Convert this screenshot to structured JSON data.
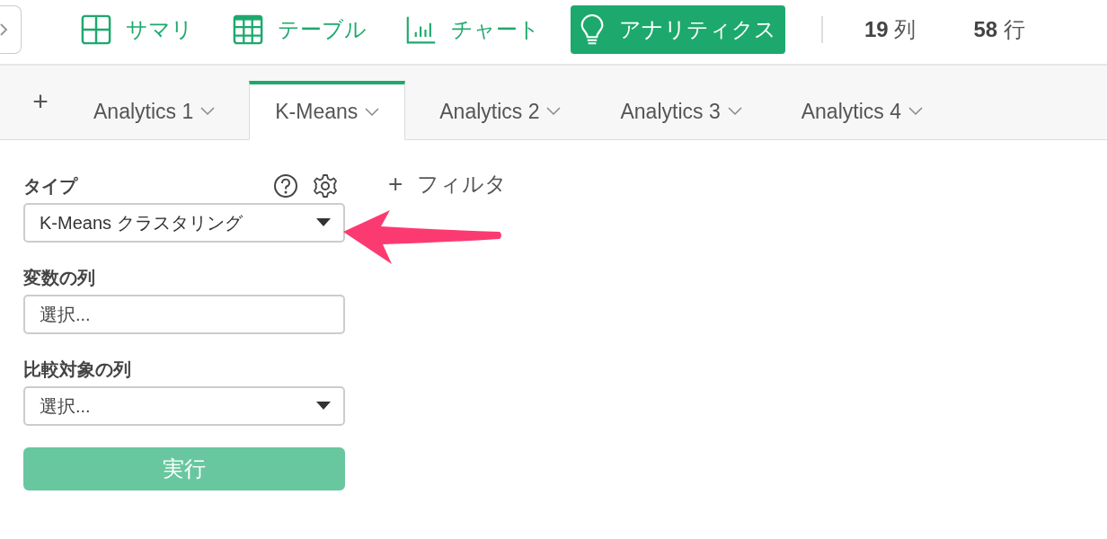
{
  "toolbar": {
    "views": [
      {
        "kind": "summary",
        "label": "サマリ",
        "selected": false
      },
      {
        "kind": "table",
        "label": "テーブル",
        "selected": false
      },
      {
        "kind": "chart",
        "label": "チャート",
        "selected": false
      },
      {
        "kind": "analytics",
        "label": "アナリティクス",
        "selected": true
      }
    ],
    "stats": [
      {
        "value": "19",
        "unit": "列"
      },
      {
        "value": "58",
        "unit": "行"
      }
    ]
  },
  "tabs": {
    "add": "+",
    "items": [
      {
        "label": "Analytics 1",
        "selected": false
      },
      {
        "label": "K-Means",
        "selected": true
      },
      {
        "label": "Analytics 2",
        "selected": false
      },
      {
        "label": "Analytics 3",
        "selected": false
      },
      {
        "label": "Analytics 4",
        "selected": false
      }
    ]
  },
  "panel": {
    "fields": [
      {
        "label": "タイプ",
        "kind": "select",
        "value": "K-Means クラスタリング",
        "help": true,
        "settings": true
      },
      {
        "label": "変数の列",
        "kind": "multi",
        "placeholder": "選択..."
      },
      {
        "label": "比較対象の列",
        "kind": "select",
        "placeholder": "選択..."
      }
    ],
    "run": {
      "label": "実行",
      "disabled": true
    }
  },
  "filter": {
    "icon": "+",
    "label": "フィルタ"
  }
}
